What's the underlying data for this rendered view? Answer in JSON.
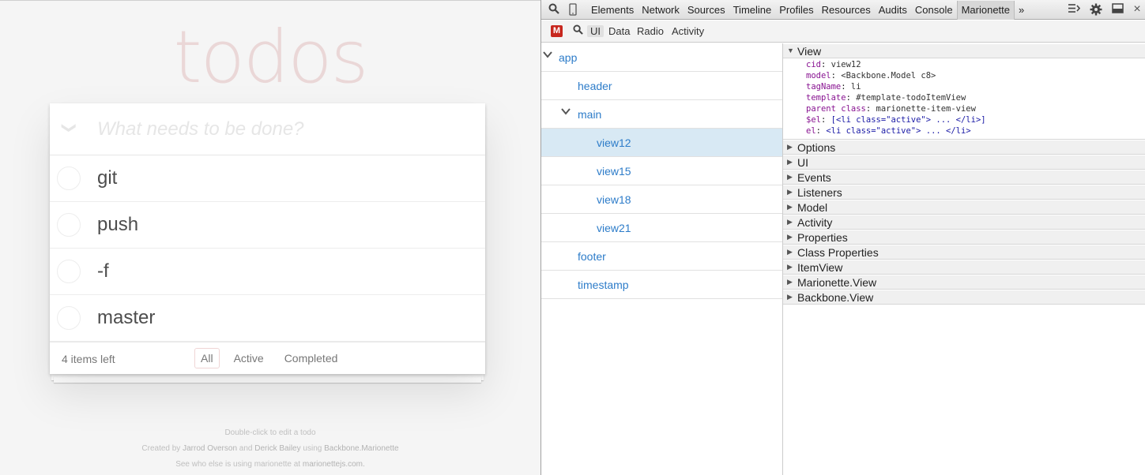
{
  "app": {
    "title": "todos",
    "new_todo_placeholder": "What needs to be done?",
    "todos": [
      {
        "label": "git"
      },
      {
        "label": "push"
      },
      {
        "label": "-f"
      },
      {
        "label": "master"
      }
    ],
    "items_left": "4 items left",
    "filters": [
      "All",
      "Active",
      "Completed"
    ],
    "info": {
      "line1": "Double-click to edit a todo",
      "created_prefix": "Created by",
      "author1": "Jarrod Overson",
      "and": "and",
      "author2": "Derick Bailey",
      "using": "using",
      "framework": "Backbone.Marionette",
      "line3_prefix": "See who else is using marionette at",
      "site": "marionettejs.com."
    }
  },
  "devtools": {
    "tabs": [
      "Elements",
      "Network",
      "Sources",
      "Timeline",
      "Profiles",
      "Resources",
      "Audits",
      "Console",
      "Marionette"
    ],
    "more": "»",
    "close": "×",
    "subtabs": [
      "UI",
      "Data",
      "Radio",
      "Activity"
    ],
    "logo": "M",
    "tree": [
      {
        "label": "app",
        "depth": 0,
        "expanded": true
      },
      {
        "label": "header",
        "depth": 1
      },
      {
        "label": "main",
        "depth": 1,
        "expanded": true
      },
      {
        "label": "view12",
        "depth": 2,
        "selected": true
      },
      {
        "label": "view15",
        "depth": 2
      },
      {
        "label": "view18",
        "depth": 2
      },
      {
        "label": "view21",
        "depth": 2
      },
      {
        "label": "footer",
        "depth": 1
      },
      {
        "label": "timestamp",
        "depth": 1
      }
    ],
    "inspector": {
      "view_title": "View",
      "props": [
        {
          "key": "cid",
          "value": "view12"
        },
        {
          "key": "model",
          "value": "<Backbone.Model c8>"
        },
        {
          "key": "tagName",
          "value": "li"
        },
        {
          "key": "template",
          "value": "#template-todoItemView"
        },
        {
          "key": "parent class",
          "value": "marionette-item-view"
        },
        {
          "key": "$el",
          "value": "[<li class=\"active\"> ... </li>]"
        },
        {
          "key": "el",
          "value": "<li class=\"active\"> ... </li>"
        }
      ],
      "sections": [
        "Options",
        "UI",
        "Events",
        "Listeners",
        "Model",
        "Activity",
        "Properties",
        "Class Properties",
        "ItemView",
        "Marionette.View",
        "Backbone.View"
      ]
    }
  }
}
